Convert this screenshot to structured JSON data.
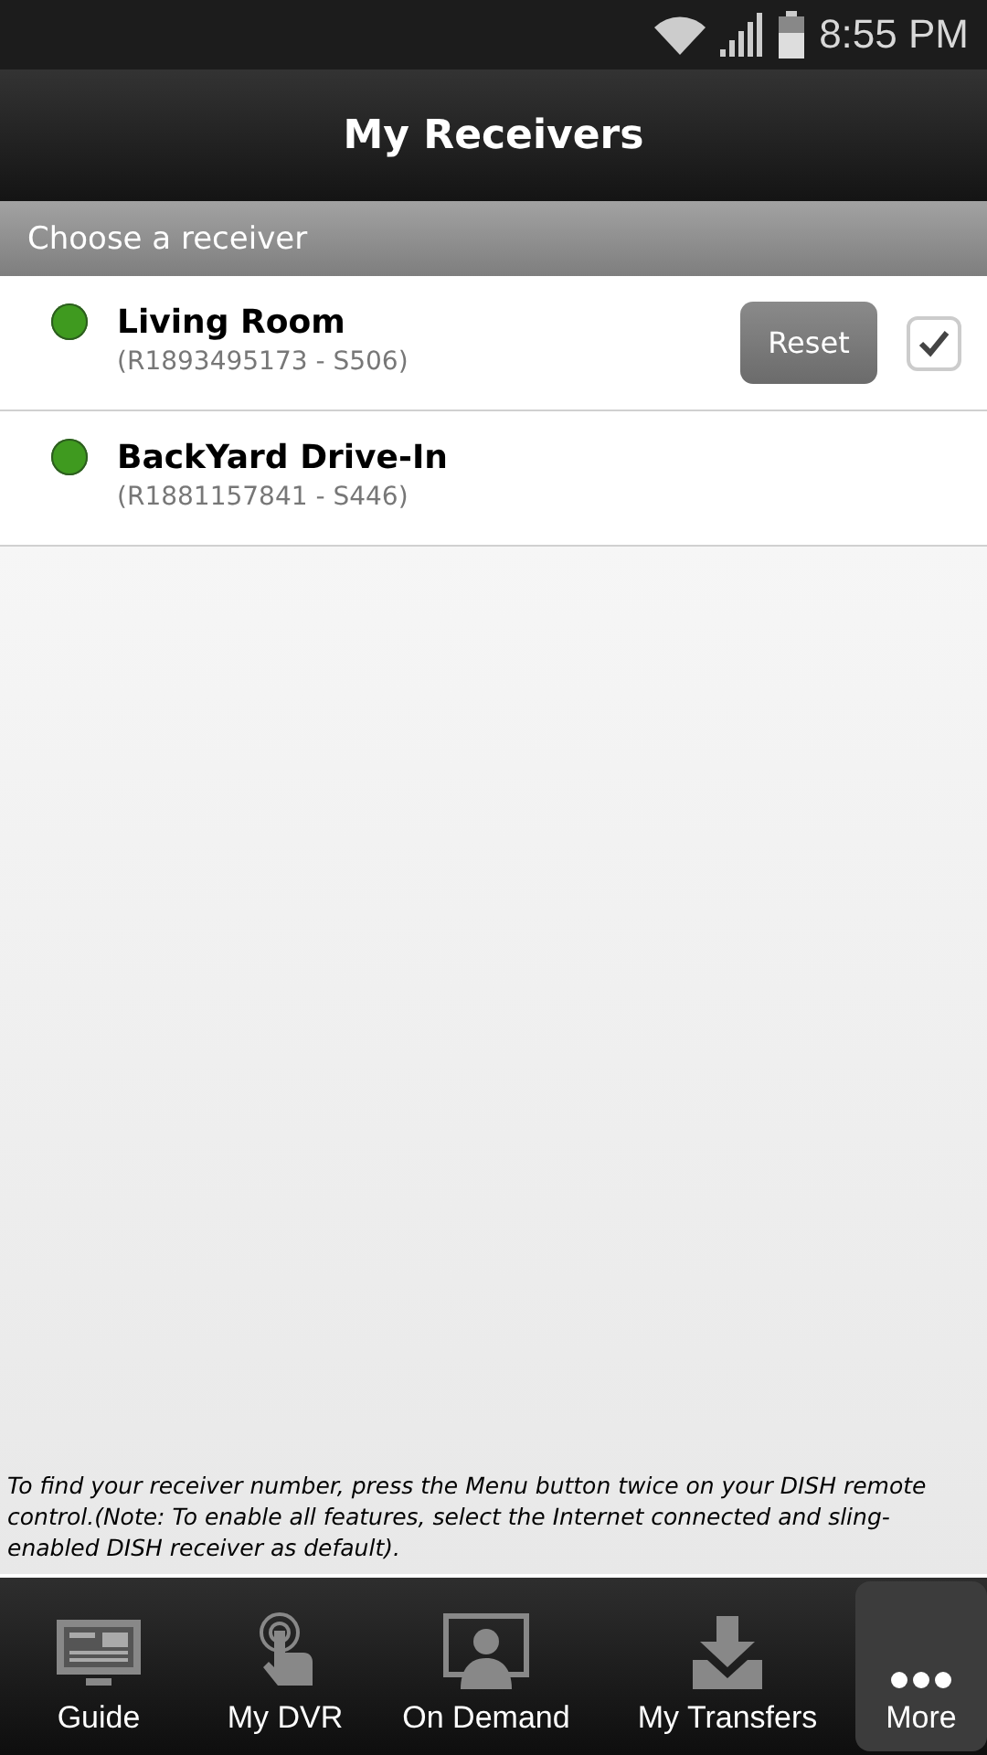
{
  "status_bar": {
    "time": "8:55 PM"
  },
  "header": {
    "title": "My Receivers"
  },
  "section": {
    "title": "Choose a receiver"
  },
  "receivers": [
    {
      "name": "Living Room",
      "number": "(R1893495173 - S506)",
      "color": "#3f9a1f",
      "checked": true,
      "reset": "Reset"
    },
    {
      "name": "BackYard Drive-In",
      "number": "(R1881157841 - S446)",
      "color": "#3f9a1f",
      "checked": false
    }
  ],
  "note": "To find your receiver number, press the Menu button twice on your DISH remote control.(Note: To enable all features, select the Internet connected and sling-enabled DISH receiver as default).",
  "tabs": [
    {
      "label": "Guide",
      "kind": "guide",
      "selected": false
    },
    {
      "label": "My DVR",
      "kind": "dvr",
      "selected": false
    },
    {
      "label": "On Demand",
      "kind": "demand",
      "selected": false
    },
    {
      "label": "My Transfers",
      "kind": "transfers",
      "selected": false
    },
    {
      "label": "More",
      "kind": "more",
      "selected": true
    }
  ]
}
